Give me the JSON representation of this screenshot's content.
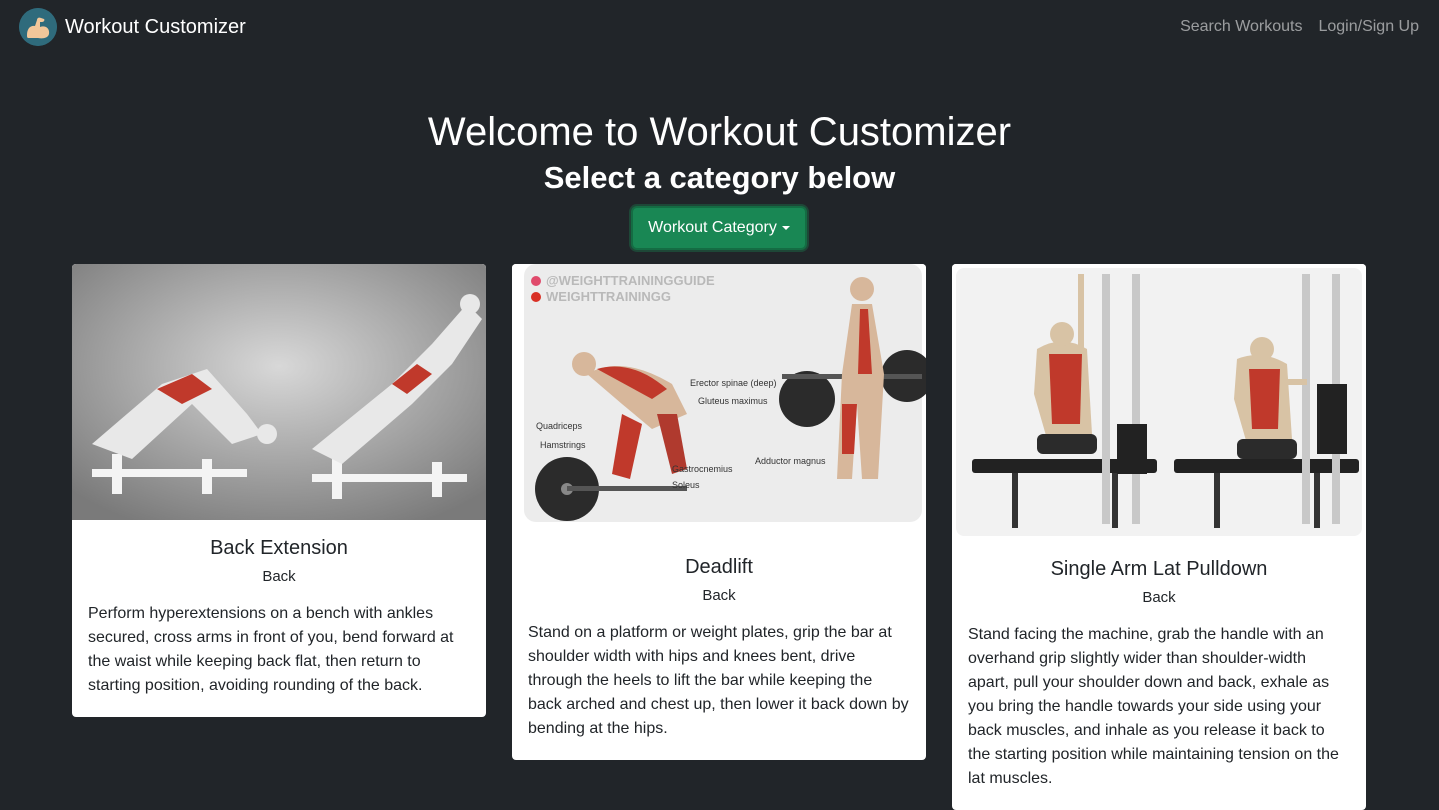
{
  "nav": {
    "brand": "Workout Customizer",
    "links": [
      "Search Workouts",
      "Login/Sign Up"
    ]
  },
  "hero": {
    "title": "Welcome to Workout Customizer",
    "subtitle": "Select a category below",
    "dropdown_label": "Workout Category"
  },
  "cards": [
    {
      "title": "Back Extension",
      "category": "Back",
      "text": "Perform hyperextensions on a bench with ankles secured, cross arms in front of you, bend forward at the waist while keeping back flat, then return to starting position, avoiding rounding of the back."
    },
    {
      "title": "Deadlift",
      "category": "Back",
      "text": "Stand on a platform or weight plates, grip the bar at shoulder width with hips and knees bent, drive through the heels to lift the bar while keeping the back arched and chest up, then lower it back down by bending at the hips.",
      "image_labels": [
        "@WEIGHTTRAININGGUIDE",
        "WEIGHTTRAININGG",
        "Erector spinae (deep)",
        "Gluteus maximus",
        "Quadriceps",
        "Hamstrings",
        "Gastrocnemius",
        "Soleus",
        "Adductor magnus"
      ]
    },
    {
      "title": "Single Arm Lat Pulldown",
      "category": "Back",
      "text": "Stand facing the machine, grab the handle with an overhand grip slightly wider than shoulder-width apart, pull your shoulder down and back, exhale as you bring the handle towards your side using your back muscles, and inhale as you release it back to the starting position while maintaining tension on the lat muscles."
    }
  ]
}
